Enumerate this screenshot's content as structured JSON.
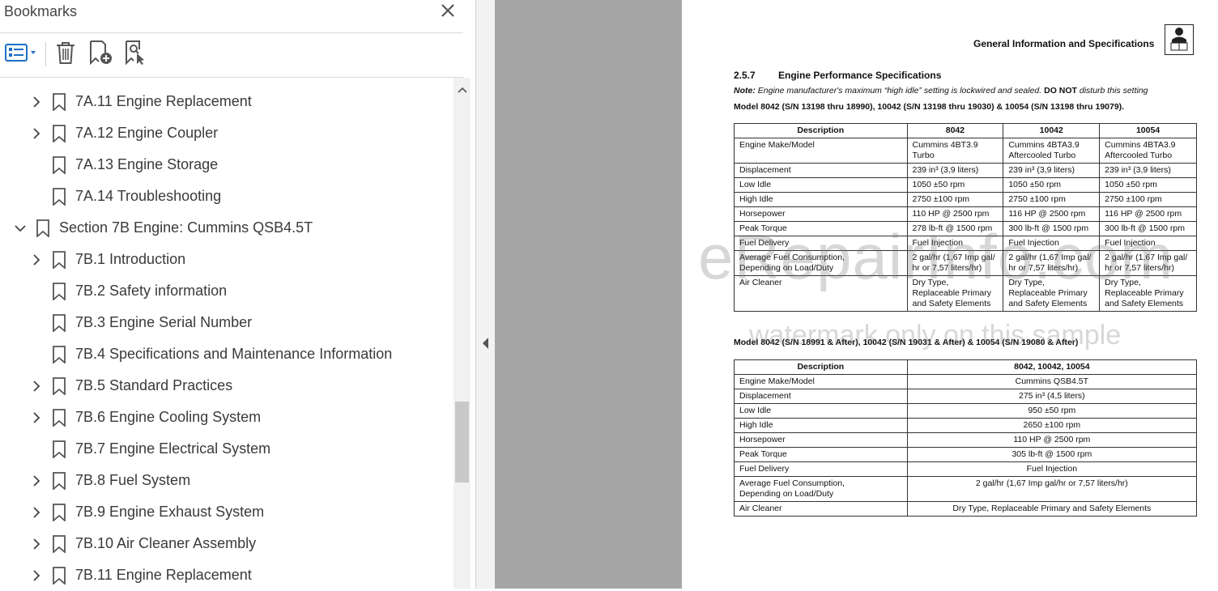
{
  "panel": {
    "title": "Bookmarks",
    "close_icon": "close-icon",
    "toolbar": [
      "bookmark-options-icon",
      "delete-bookmark-icon",
      "new-bookmark-icon",
      "find-bookmark-icon"
    ]
  },
  "bookmarks": [
    {
      "label": "7A.11 Engine Replacement",
      "expandable": true,
      "expanded": false,
      "indent": 2
    },
    {
      "label": "7A.12 Engine Coupler",
      "expandable": true,
      "expanded": false,
      "indent": 2
    },
    {
      "label": "7A.13 Engine Storage",
      "expandable": false,
      "expanded": false,
      "indent": 2
    },
    {
      "label": "7A.14 Troubleshooting",
      "expandable": false,
      "expanded": false,
      "indent": 2
    },
    {
      "label": "Section 7B Engine: Cummins QSB4.5T",
      "expandable": true,
      "expanded": true,
      "indent": 1
    },
    {
      "label": "7B.1 Introduction",
      "expandable": true,
      "expanded": false,
      "indent": 2
    },
    {
      "label": "7B.2 Safety information",
      "expandable": false,
      "expanded": false,
      "indent": 2
    },
    {
      "label": "7B.3 Engine Serial Number",
      "expandable": false,
      "expanded": false,
      "indent": 2
    },
    {
      "label": "7B.4 Specifications and Maintenance Information",
      "expandable": false,
      "expanded": false,
      "indent": 2
    },
    {
      "label": "7B.5 Standard Practices",
      "expandable": true,
      "expanded": false,
      "indent": 2
    },
    {
      "label": "7B.6 Engine Cooling System",
      "expandable": true,
      "expanded": false,
      "indent": 2
    },
    {
      "label": "7B.7 Engine Electrical System",
      "expandable": false,
      "expanded": false,
      "indent": 2
    },
    {
      "label": "7B.8 Fuel System",
      "expandable": true,
      "expanded": false,
      "indent": 2
    },
    {
      "label": "7B.9 Engine Exhaust System",
      "expandable": true,
      "expanded": false,
      "indent": 2
    },
    {
      "label": "7B.10 Air Cleaner Assembly",
      "expandable": true,
      "expanded": false,
      "indent": 2
    },
    {
      "label": "7B.11 Engine Replacement",
      "expandable": true,
      "expanded": false,
      "indent": 2
    }
  ],
  "document": {
    "header": "General Information and Specifications",
    "section_number": "2.5.7",
    "section_title": "Engine Performance Specifications",
    "note_label": "Note:",
    "note_text": "Engine manufacturer's maximum “high idle” setting is lockwired and sealed.",
    "note_emph": "DO NOT",
    "note_tail": "disturb this setting",
    "model1": "Model 8042 (S/N 13198 thru 18990), 10042 (S/N 13198 thru 19030) & 10054 (S/N 13198 thru 19079).",
    "table1": {
      "headers": [
        "Description",
        "8042",
        "10042",
        "10054"
      ],
      "rows": [
        [
          "Engine Make/Model",
          "Cummins 4BT3.9\nTurbo",
          "Cummins 4BTA3.9\nAftercooled Turbo",
          "Cummins 4BTA3.9\nAftercooled Turbo"
        ],
        [
          "Displacement",
          "239 in³ (3,9 liters)",
          "239 in³ (3,9 liters)",
          "239 in³ (3,9 liters)"
        ],
        [
          "Low Idle",
          "1050 ±50 rpm",
          "1050 ±50 rpm",
          "1050 ±50 rpm"
        ],
        [
          "High Idle",
          "2750 ±100 rpm",
          "2750 ±100 rpm",
          "2750 ±100 rpm"
        ],
        [
          "Horsepower",
          "110 HP @ 2500 rpm",
          "116 HP @ 2500 rpm",
          "116 HP @ 2500 rpm"
        ],
        [
          "Peak Torque",
          "278 lb-ft @ 1500 rpm",
          "300 lb-ft @ 1500 rpm",
          "300 lb-ft @ 1500 rpm"
        ],
        [
          "Fuel Delivery",
          "Fuel Injection",
          "Fuel Injection",
          "Fuel Injection"
        ],
        [
          "Average Fuel Consumption,\nDepending on Load/Duty",
          "2 gal/hr (1,67 Imp gal/\nhr or 7,57 liters/hr)",
          "2 gal/hr (1,67 Imp gal/\nhr or 7,57 liters/hr)",
          "2 gal/hr (1,67 Imp gal/\nhr or 7,57 liters/hr)"
        ],
        [
          "Air Cleaner",
          "Dry Type,\nReplaceable Primary\nand Safety Elements",
          "Dry Type,\nReplaceable Primary\nand Safety Elements",
          "Dry Type,\nReplaceable Primary\nand Safety Elements"
        ]
      ]
    },
    "model2": "Model 8042 (S/N 18991 & After), 10042 (S/N 19031 & After) & 10054 (S/N 19080 & After)",
    "table2": {
      "headers": [
        "Description",
        "8042, 10042, 10054"
      ],
      "rows": [
        [
          "Engine Make/Model",
          "Cummins QSB4.5T"
        ],
        [
          "Displacement",
          "275 in³ (4,5 liters)"
        ],
        [
          "Low Idle",
          "950 ±50 rpm"
        ],
        [
          "High Idle",
          "2650 ±100 rpm"
        ],
        [
          "Horsepower",
          "110 HP @ 2500 rpm"
        ],
        [
          "Peak Torque",
          "305 lb-ft @ 1500 rpm"
        ],
        [
          "Fuel Delivery",
          "Fuel Injection"
        ],
        [
          "Average Fuel Consumption,\nDepending on Load/Duty",
          "2 gal/hr (1,67 Imp gal/hr or 7,57 liters/hr)"
        ],
        [
          "Air Cleaner",
          "Dry Type, Replaceable Primary and Safety Elements"
        ]
      ]
    },
    "watermark": "eRepairInfo.com",
    "watermark_sub": "watermark only on this sample"
  }
}
